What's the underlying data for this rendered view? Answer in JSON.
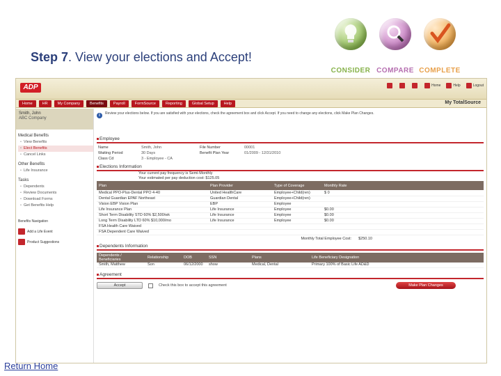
{
  "slide": {
    "title_bold": "Step 7",
    "title_rest": ". View your elections and Accept!",
    "return_home": "Return Home"
  },
  "steps": [
    {
      "label": "CONSIDER",
      "icon": "lightbulb-icon"
    },
    {
      "label": "COMPARE",
      "icon": "magnifier-icon"
    },
    {
      "label": "COMPLETE",
      "icon": "checkmark-icon"
    }
  ],
  "app": {
    "logo": "ADP",
    "top_links": [
      "",
      "",
      "",
      "Home",
      "Help",
      "Logout"
    ],
    "nav": [
      "Home",
      "HR",
      "My Company",
      "Benefits",
      "Payroll",
      "FormSource",
      "Reporting",
      "Global Setup",
      "Help"
    ],
    "active_nav": "Benefits",
    "brand": "My TotalSource",
    "user": {
      "name": "Smith, John",
      "company": "ABC Company"
    },
    "sidebar": {
      "medical_title": "Medical Benefits",
      "medical_items": [
        "View Benefits",
        "Elect Benefits",
        "Cancel Links"
      ],
      "other_title": "Other Benefits",
      "other_items": [
        "Life Insurance"
      ],
      "tasks_title": "Tasks",
      "tasks_items": [
        "Dependents",
        "Review Documents",
        "Download Forms",
        "Get Benefits Help"
      ],
      "utilities": [
        "Benefits Navigation",
        "Add a Life Event",
        "Product Suggestions"
      ]
    },
    "info_text": "Review your elections below. If you are satisfied with your elections, check the agreement box and click Accept. If you need to change any elections, click Make Plan Changes.",
    "employee": {
      "heading": "Employee",
      "rows": [
        [
          "Name",
          "Smith, John",
          "File Number",
          "00001"
        ],
        [
          "Waiting Period",
          "30 Days",
          "Benefit Plan Year",
          "01/2009 - 12/31/2010"
        ],
        [
          "Class Cd",
          "3 - Employee - CA",
          "",
          ""
        ]
      ]
    },
    "elections": {
      "heading": "Elections Information",
      "pay_frequency": "Your current pay frequency is Semi-Monthly",
      "deduction": "Your estimated per pay deduction cost: $125.05",
      "columns": [
        "Plan",
        "Plan Provider",
        "Type of Coverage",
        "Monthly Rate"
      ],
      "rows": [
        [
          "Medical PPO-Plus-Dental PPO 4-40",
          "United HealthCare",
          "Employee+Child(ren)",
          "$ 0"
        ],
        [
          "Dental Guardian EPAF Northeast",
          "Guardian Dental",
          "Employee+Child(ren)",
          ""
        ],
        [
          "Vision EBP Vision Plan",
          "EBP",
          "Employee",
          ""
        ],
        [
          "Life Insurance Plan",
          "Life Insurance",
          "Employee",
          "$0.00"
        ],
        [
          "Short Term Disability STD 60% $2,500/wk",
          "Life Insurance",
          "Employee",
          "$0.00"
        ],
        [
          "Long Term Disability LTD 60% $10,000/mo",
          "Life Insurance",
          "Employee",
          "$0.00"
        ],
        [
          "FSA Health Care Waived",
          "",
          "",
          ""
        ],
        [
          "FSA Dependent Care Waived",
          "",
          "",
          ""
        ]
      ],
      "total_label": "Monthly Total Employee Cost:",
      "total_value": "$250.10"
    },
    "dependents": {
      "heading": "Dependents Information",
      "columns": [
        "Dependents / Beneficiaries",
        "Relationship",
        "DOB",
        "SSN",
        "Plans",
        "Life Beneficiary Designation"
      ],
      "rows": [
        [
          "Smith, Matthew",
          "Son",
          "06/12/2000",
          "show",
          "Medical, Dental",
          "Primary 100% of Basic Life AD&D"
        ]
      ]
    },
    "agreement": {
      "heading": "Agreement",
      "accept": "Accept",
      "checkbox_text": "Check this box to accept this agreement",
      "make_changes": "Make Plan Changes"
    }
  },
  "colors": {
    "accent": "#c3262c",
    "nav_red": "#b8171f",
    "title_blue": "#2b3f7a"
  }
}
